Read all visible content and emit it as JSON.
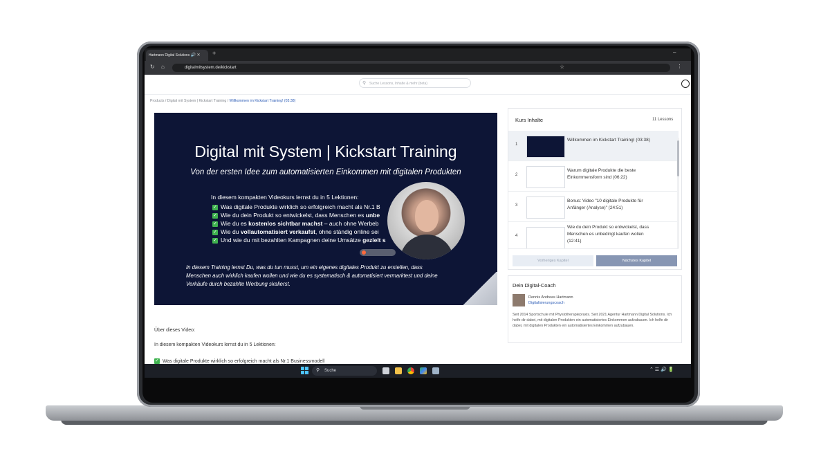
{
  "browser": {
    "tab_title": "Hartmann Digital Solutions",
    "url": "digitalmitsystem.de/kickstart"
  },
  "site": {
    "search_placeholder": "Suche Lessons, Inhalte & mehr (beta)",
    "breadcrumb": {
      "path": "Products / Digital mit System | Kickstart Training",
      "separator": " / ",
      "current": "Willkommen im Kickstart Training! (03:38)"
    }
  },
  "video": {
    "title": "Digital mit System | Kickstart Training",
    "subtitle": "Von der ersten Idee zum automatisierten Einkommen mit digitalen Produkten",
    "intro": "In diesem kompakten Videokurs lernst du in 5 Lektionen:",
    "bullets": [
      {
        "a": "Was digitale Produkte wirklich so erfolgreich macht als Nr.1 B",
        "b": "",
        "c": ""
      },
      {
        "a": "Wie du dein Produkt so entwickelst, dass Menschen es ",
        "b": "unbe",
        "c": ""
      },
      {
        "a": "Wie du es ",
        "b": "kostenlos sichtbar machst",
        "c": " – auch ohne Werbeb"
      },
      {
        "a": "Wie du ",
        "b": "vollautomatisiert verkaufst",
        "c": ", ohne ständig online sei"
      },
      {
        "a": "Und wie du mit bezahlten Kampagnen deine Umsätze ",
        "b": "gezielt s",
        "c": ""
      }
    ],
    "paragraph": "In diesem Training lernst Du, was du tun musst, um ein eigenes digitales Produkt zu erstellen, dass Menschen auch wirklich kaufen wollen und wie du es systematisch & automatisiert vermarktest und deine Verkäufe durch bezahlte Werbung skalierst."
  },
  "about": {
    "heading": "Über dieses Video:",
    "intro": "In diesem kompakten Videokurs lernst du in 5 Lektionen:",
    "first_item": "Was digitale Produkte wirklich so erfolgreich macht als Nr.1 Businessmodell"
  },
  "course": {
    "heading": "Kurs Inhalte",
    "count": "11 Lessons",
    "lessons": [
      {
        "num": "1",
        "title": "Willkommen im Kickstart Training! (03:38)"
      },
      {
        "num": "2",
        "title": "Warum digitale Produkte die beste Einkommensform sind (06:22)"
      },
      {
        "num": "3",
        "title": "Bonus: Video \"10 digitale Produkte für Anfänger (Analyse)\" (24:51)"
      },
      {
        "num": "4",
        "title": "Wie du dein Produkt so entwickelst, dass Menschen es unbedingt kaufen wollen (12:41)"
      }
    ],
    "prev": "Vorheriges Kapitel",
    "next": "Nächstes Kapitel"
  },
  "coach": {
    "heading": "Dein Digital-Coach",
    "name": "Dennis Andreas Hartmann",
    "role": "Digitalisierungscoach",
    "bio": "Seit 2014 Sportschule mit Physiotherapiepraxis. Seit 2021 Agentur Hartmann Digital Solutions. Ich helfe dir dabei, mit digitalen Produkten ein automatisiertes Einkommen aufzubauen. Ich helfe dir dabei, mit digitalen Produkten ein automatisiertes Einkommen aufzubauen."
  },
  "taskbar": {
    "search": "Suche"
  },
  "colors": {
    "video_bg": "#0d1536",
    "accent": "#2b5bb5",
    "check": "#3fb24f",
    "next_button": "#8796b3"
  }
}
